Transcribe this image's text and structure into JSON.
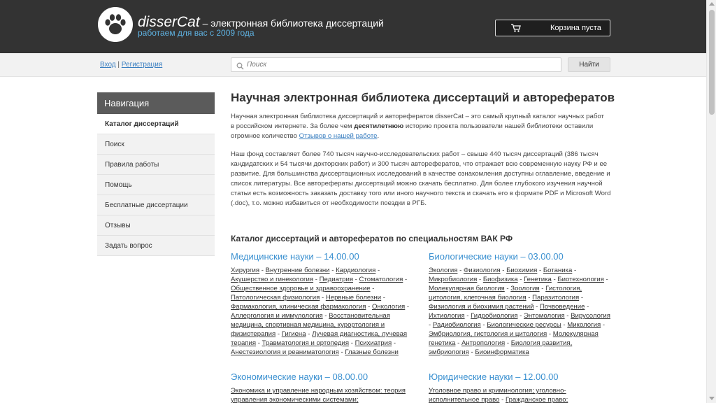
{
  "header": {
    "brand_name": "disserCat",
    "brand_tagline": " – электронная библиотека диссертаций",
    "brand_sub": "работаем для вас с 2009 года",
    "cart_label": "Корзина пуста"
  },
  "searchbar": {
    "login": "Вход",
    "separator": " | ",
    "register": "Регистрация",
    "placeholder": "Поиск",
    "button": "Найти"
  },
  "nav": {
    "title": "Навигация",
    "items": [
      {
        "label": "Каталог диссертаций",
        "active": true
      },
      {
        "label": "Поиск"
      },
      {
        "label": "Правила работы"
      },
      {
        "label": "Помощь"
      },
      {
        "label": "Бесплатные диссертации"
      },
      {
        "label": "Отзывы"
      },
      {
        "label": "Задать вопрос"
      }
    ]
  },
  "main": {
    "title": "Научная электронная библиотека диссертаций и авторефератов",
    "intro_1": "Научная электронная библиотека диссертаций и авторефератов disserCat – это самый крупный каталог научных работ в российском интернете. За более чем ",
    "intro_bold": "десятилетнюю",
    "intro_2": " историю проекта пользователи нашей библиотеки оставили огромное количество ",
    "intro_link": "Отзывов о нашей работе",
    "intro_3": ".",
    "fund_text": "Наш фонд составляет более 740 тысяч научно-исследовательских работ – свыше 440 тысяч диссертаций (386 тысяч кандидатских и 54 тысячи докторских работ) и 300 тысяч авторефератов, что отражает всю современную науку РФ и ее развитие. Для большинства диссертационных исследований в качестве ознакомления доступны оглавление, введение и список литературы. Все авторефераты диссертаций можно скачать бесплатно. Для более глубокого изучения научной статьи есть возможность заказать доставку того или иного научного текста и скачать его в формате PDF и Microsoft Word (.doc), т.о. можно избавиться от необходимости поездки в РГБ.",
    "catalog_title": "Каталог диссертаций и авторефератов по специальностям ВАК РФ"
  },
  "categories": {
    "medical": {
      "title": "Медицинские науки – 14.00.00",
      "links": [
        "Хирургия",
        "Внутренние болезни",
        "Кардиология",
        "Акушерство и гинекология",
        "Педиатрия",
        "Стоматология",
        "Общественное здоровье и здравоохранение",
        "Патологическая физиология",
        "Нервные болезни",
        "Фармакология, клиническая фармакология",
        "Онкология",
        "Аллергология и иммулология",
        "Восстановительная медицина, спортивная медицина, курортология и физиотерапия",
        "Гигиена",
        "Лучевая диагностика, лучевая терапия",
        "Травматология и ортопедия",
        "Психиатрия",
        "Анестезиология и реаниматология",
        "Глазные болезни"
      ]
    },
    "biology": {
      "title": "Биологические науки – 03.00.00",
      "links": [
        "Экология",
        "Физиология",
        "Биохимия",
        "Ботаника",
        "Микробиология",
        "Биофизика",
        "Генетика",
        "Биотехнология",
        "Молекулярная биология",
        "Зоология",
        "Гистология, цитология, клеточная биология",
        "Паразитология",
        "Физиология и биохимия растений",
        "Почвоведение",
        "Ихтиология",
        "Гидробиология",
        "Энтомология",
        "Вирусология",
        "Радиобиология",
        "Биологические ресурсы",
        "Микология",
        "Эмбриология, гистология и цитология",
        "Молекулярная генетика",
        "Антропология",
        "Биология развития, эмбриология",
        "Биоинформатика"
      ]
    },
    "economics": {
      "title": "Экономические науки – 08.00.00",
      "links": [
        "Экономика и управление народным хозяйством: теория управления экономическими системами;"
      ]
    },
    "law": {
      "title": "Юридические науки – 12.00.00",
      "links": [
        "Уголовное право и криминология; уголовно-исполнительное право",
        "Гражданское право;"
      ]
    }
  },
  "colors": {
    "header_bg": "#333333",
    "accent": "#3a90d0",
    "nav_head_bg": "#5b5b5b"
  }
}
